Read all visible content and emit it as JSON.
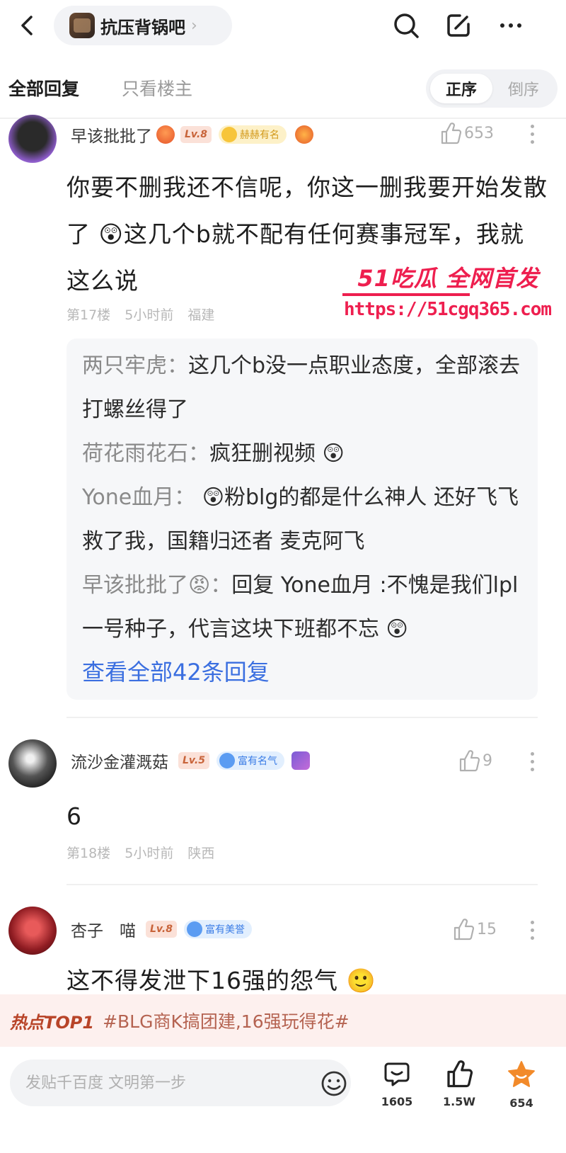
{
  "header": {
    "forum_name": "抗压背锅吧",
    "chevron": "›"
  },
  "tabs": {
    "all_replies": "全部回复",
    "op_only": "只看楼主",
    "order_asc": "正序",
    "order_desc": "倒序"
  },
  "comments": [
    {
      "username": "早该批批了",
      "level": "Lv.8",
      "honor": "赫赫有名",
      "likes": "653",
      "text": "你要不删我还不信呢，你这一删我要开始发散了 😲这几个b就不配有任何赛事冠军，我就这么说",
      "floor": "第17楼",
      "time": "5小时前",
      "location": "福建",
      "replies": [
        {
          "who": "两只牢虎：",
          "text": "这几个b没一点职业态度，全部滚去打螺丝得了"
        },
        {
          "who": "荷花雨花石：",
          "text": "疯狂删视频 😲"
        },
        {
          "who": "Yone血月：",
          "text": " 😲粉blg的都是什么神人 还好飞飞救了我，国籍归还者 麦克阿飞"
        },
        {
          "who": "早该批批了😡：",
          "text": "回复 Yone血月 :不愧是我们lpl一号种子，代言这块下班都不忘 😲"
        }
      ],
      "view_all": "查看全部42条回复"
    },
    {
      "username": "流沙金灌溉菇",
      "level": "Lv.5",
      "honor": "富有名气",
      "likes": "9",
      "text": "6",
      "floor": "第18楼",
      "time": "5小时前",
      "location": "陕西"
    },
    {
      "username": "杏子　喵",
      "level": "Lv.8",
      "honor": "富有美誉",
      "likes": "15",
      "text": "这不得发泄下16强的怨气 🙂"
    }
  ],
  "watermark": {
    "title": "51吃瓜 全网首发",
    "url": "https://51cgq365.com"
  },
  "hot": {
    "tag": "热点TOP1",
    "topic": "#BLG商K搞团建,16强玩得花#"
  },
  "bottom": {
    "input_placeholder": "发贴千百度 文明第一步",
    "comment_count": "1605",
    "like_count": "1.5W",
    "fav_count": "654"
  },
  "colors": {
    "link_blue": "#3b6fe0",
    "brand_red": "#ee1f4f",
    "star_orange": "#f28a2a"
  }
}
